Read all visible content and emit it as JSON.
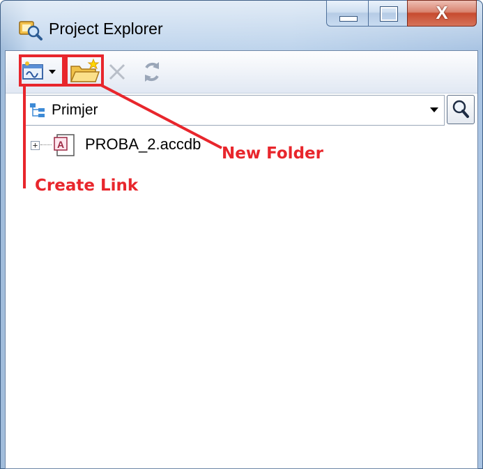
{
  "window": {
    "title": "Project Explorer",
    "icon": "project-explorer-icon",
    "controls": {
      "minimize": "minimize-icon",
      "maximize": "maximize-icon",
      "close_glyph": "X"
    }
  },
  "toolbar": {
    "buttons": [
      {
        "icon": "create-link-icon",
        "has_dropdown": true
      },
      {
        "icon": "new-folder-icon"
      },
      {
        "icon": "delete-icon",
        "enabled": false
      },
      {
        "icon": "refresh-icon"
      }
    ]
  },
  "location": {
    "value": "Primjer",
    "icon": "project-tree-icon"
  },
  "search": {
    "icon": "search-icon"
  },
  "tree": {
    "items": [
      {
        "label": "PROBA_2.accdb",
        "expander": "+",
        "icon": "access-database-icon"
      }
    ]
  },
  "annotations": {
    "new_folder": "New Folder",
    "create_link": "Create Link",
    "color": "#e8262c"
  }
}
